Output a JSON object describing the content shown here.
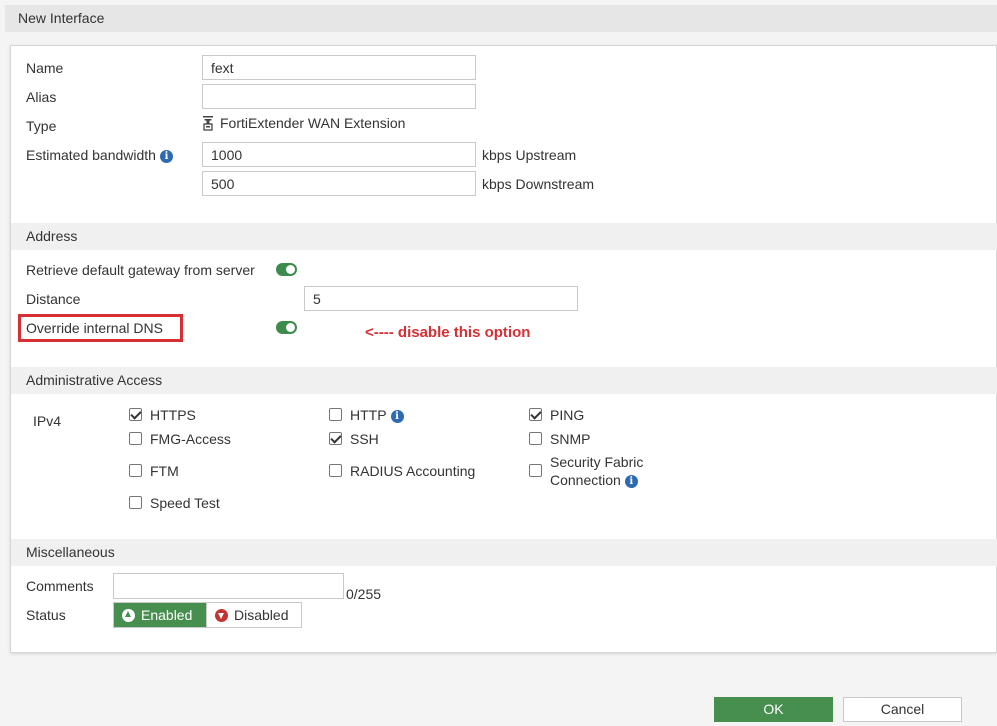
{
  "dialog": {
    "title": "New Interface"
  },
  "general": {
    "name_label": "Name",
    "name_value": "fext",
    "alias_label": "Alias",
    "alias_value": "",
    "type_label": "Type",
    "type_value": "FortiExtender WAN Extension",
    "bandwidth_label": "Estimated bandwidth",
    "upstream_value": "1000",
    "upstream_unit": "kbps Upstream",
    "downstream_value": "500",
    "downstream_unit": "kbps Downstream"
  },
  "address": {
    "header": "Address",
    "retrieve_gateway_label": "Retrieve default gateway from server",
    "retrieve_gateway_enabled": true,
    "distance_label": "Distance",
    "distance_value": "5",
    "override_dns_label": "Override internal DNS",
    "override_dns_enabled": true,
    "annotation": "<---- disable this option"
  },
  "admin_access": {
    "header": "Administrative Access",
    "ipv4_label": "IPv4",
    "options": [
      {
        "label": "HTTPS",
        "checked": true
      },
      {
        "label": "HTTP",
        "checked": false
      },
      {
        "label": "PING",
        "checked": true
      },
      {
        "label": "FMG-Access",
        "checked": false
      },
      {
        "label": "SSH",
        "checked": true
      },
      {
        "label": "SNMP",
        "checked": false
      },
      {
        "label": "FTM",
        "checked": false
      },
      {
        "label": "RADIUS Accounting",
        "checked": false
      },
      {
        "label": "Security Fabric",
        "label2": "Connection",
        "checked": false
      },
      {
        "label": "Speed Test",
        "checked": false
      }
    ]
  },
  "misc": {
    "header": "Miscellaneous",
    "comments_label": "Comments",
    "comments_value": "",
    "comments_counter": "0/255",
    "status_label": "Status",
    "status_enabled": "Enabled",
    "status_disabled": "Disabled",
    "status_current": "Enabled"
  },
  "footer": {
    "ok_label": "OK",
    "cancel_label": "Cancel"
  },
  "colors": {
    "accent_green": "#468f4f",
    "toggle_green": "#3d8b4d",
    "annotation_red": "#d62f34",
    "info_blue": "#2d6ab0"
  }
}
